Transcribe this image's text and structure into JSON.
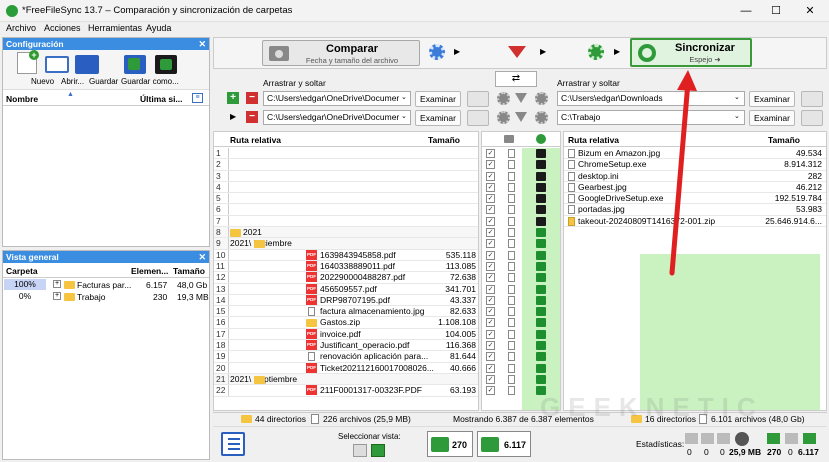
{
  "window": {
    "title": "*FreeFileSync 13.7 – Comparación y sincronización de carpetas",
    "minimize": "—",
    "maximize": "☐",
    "close": "✕"
  },
  "menu": [
    "Archivo",
    "Acciones",
    "Herramientas",
    "Ayuda"
  ],
  "config_panel": {
    "title": "Configuración",
    "toolbar": [
      "Nuevo",
      "Abrir...",
      "Guardar",
      "Guardar como..."
    ],
    "col_name": "Nombre",
    "col_last": "Última si..."
  },
  "overview_panel": {
    "title": "Vista general",
    "cols": [
      "Carpeta",
      "Elemen...",
      "Tamaño"
    ],
    "rows": [
      {
        "pct": "100%",
        "pct_fill": 1.0,
        "name": "Facturas par...",
        "elements": "6.157",
        "size": "48,0 Gb"
      },
      {
        "pct": "0%",
        "pct_fill": 0.0,
        "name": "Trabajo",
        "elements": "230",
        "size": "19,3 MB"
      }
    ]
  },
  "compare": {
    "label": "Comparar",
    "sub": "Fecha y tamaño del archivo"
  },
  "sync": {
    "label": "Sincronizar",
    "sub": "Espejo ➜"
  },
  "left": {
    "drag_label": "Arrastrar y soltar",
    "paths": [
      "C:\\Users\\edgar\\OneDrive\\Documer",
      "C:\\Users\\edgar\\OneDrive\\Documer"
    ],
    "browse": "Examinar",
    "col_path": "Ruta relativa",
    "col_size": "Tamaño"
  },
  "right": {
    "drag_label": "Arrastrar y soltar",
    "paths": [
      "C:\\Users\\edgar\\Downloads",
      "C:\\Trabajo"
    ],
    "browse": "Examinar",
    "col_path": "Ruta relativa",
    "col_size": "Tamaño",
    "files": [
      {
        "name": "Bizum en Amazon.jpg",
        "size": "49.534"
      },
      {
        "name": "ChromeSetup.exe",
        "size": "8.914.312"
      },
      {
        "name": "desktop.ini",
        "size": "282"
      },
      {
        "name": "Gearbest.jpg",
        "size": "46.212"
      },
      {
        "name": "GoogleDriveSetup.exe",
        "size": "192.519.784"
      },
      {
        "name": "portadas.jpg",
        "size": "53.983"
      },
      {
        "name": "takeout-20240809T1416372-001.zip",
        "size": "25.646.914.6..."
      }
    ]
  },
  "left_rows": [
    {
      "n": "1",
      "name": "",
      "size": ""
    },
    {
      "n": "2",
      "name": "",
      "size": ""
    },
    {
      "n": "3",
      "name": "",
      "size": ""
    },
    {
      "n": "4",
      "name": "",
      "size": ""
    },
    {
      "n": "5",
      "name": "",
      "size": ""
    },
    {
      "n": "6",
      "name": "",
      "size": ""
    },
    {
      "n": "7",
      "name": "",
      "size": ""
    },
    {
      "n": "8",
      "name": "2021",
      "size": "",
      "type": "folder"
    },
    {
      "n": "9",
      "name": "2021\\ Diciembre",
      "size": "",
      "type": "folder"
    },
    {
      "n": "10",
      "name": "1639843945858.pdf",
      "size": "535.118",
      "type": "pdf"
    },
    {
      "n": "11",
      "name": "1640338889011.pdf",
      "size": "113.085",
      "type": "pdf"
    },
    {
      "n": "12",
      "name": "202290000488287.pdf",
      "size": "72.638",
      "type": "pdf"
    },
    {
      "n": "13",
      "name": "456509557.pdf",
      "size": "341.701",
      "type": "pdf"
    },
    {
      "n": "14",
      "name": "DRP98707195.pdf",
      "size": "43.337",
      "type": "pdf"
    },
    {
      "n": "15",
      "name": "factura almacenamiento.jpg",
      "size": "82.633",
      "type": "file"
    },
    {
      "n": "16",
      "name": "Gastos.zip",
      "size": "1.108.108",
      "type": "folder"
    },
    {
      "n": "17",
      "name": "invoice.pdf",
      "size": "104.005",
      "type": "pdf"
    },
    {
      "n": "18",
      "name": "Justificant_operacio.pdf",
      "size": "116.368",
      "type": "pdf"
    },
    {
      "n": "19",
      "name": "renovación aplicación para...",
      "size": "81.644",
      "type": "file"
    },
    {
      "n": "20",
      "name": "Ticket202112160017008026...",
      "size": "40.666",
      "type": "pdf"
    },
    {
      "n": "21",
      "name": "2021\\ Septiembre",
      "size": "",
      "type": "folder"
    },
    {
      "n": "22",
      "name": "211F0001317-00323F.PDF",
      "size": "63.193",
      "type": "pdf"
    }
  ],
  "status": {
    "left_dirs": "44 directorios",
    "left_files": "226 archivos (25,9 MB)",
    "showing": "Mostrando 6.387 de 6.387 elementos",
    "right_dirs": "16 directorios",
    "right_files": "6.101 archivos (48,0 Gb)"
  },
  "bottom": {
    "select_view": "Seleccionar vista:",
    "count_left": "270",
    "count_right": "6.117",
    "stats_label": "Estadísticas:",
    "stats": [
      "0",
      "0",
      "0",
      "25,9 MB",
      "270",
      "0",
      "6.117"
    ]
  },
  "watermark": "GEEKNETIC",
  "colors": {
    "accent_blue": "#3a8de0",
    "sync_green": "#1e8f2e",
    "red_arrow": "#e02020"
  }
}
